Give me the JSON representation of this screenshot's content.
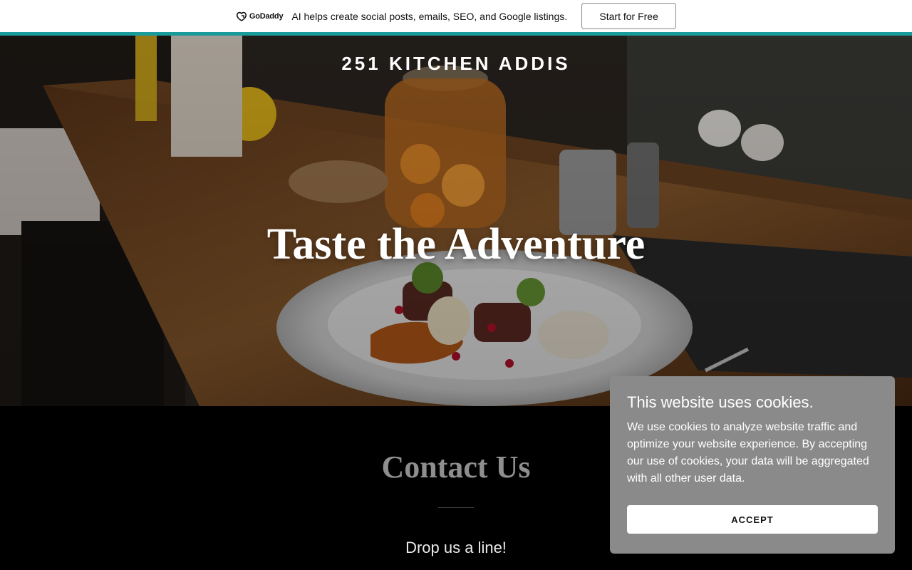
{
  "promo": {
    "logo_text": "GoDaddy",
    "logo_icon": "godaddy-logo-icon",
    "message": "AI helps create social posts, emails, SEO, and Google listings.",
    "cta_label": "Start for Free",
    "accent_color": "#1a9b9b"
  },
  "hero": {
    "site_title": "251 KITCHEN ADDIS",
    "heading": "Taste the Adventure"
  },
  "contact": {
    "title": "Contact Us",
    "subtitle": "Drop us a line!"
  },
  "cookie": {
    "title": "This website uses cookies.",
    "body": "We use cookies to analyze website traffic and optimize your website experience. By accepting our use of cookies, your data will be aggregated with all other user data.",
    "accept_label": "ACCEPT",
    "background_color": "#8a8a8a"
  }
}
